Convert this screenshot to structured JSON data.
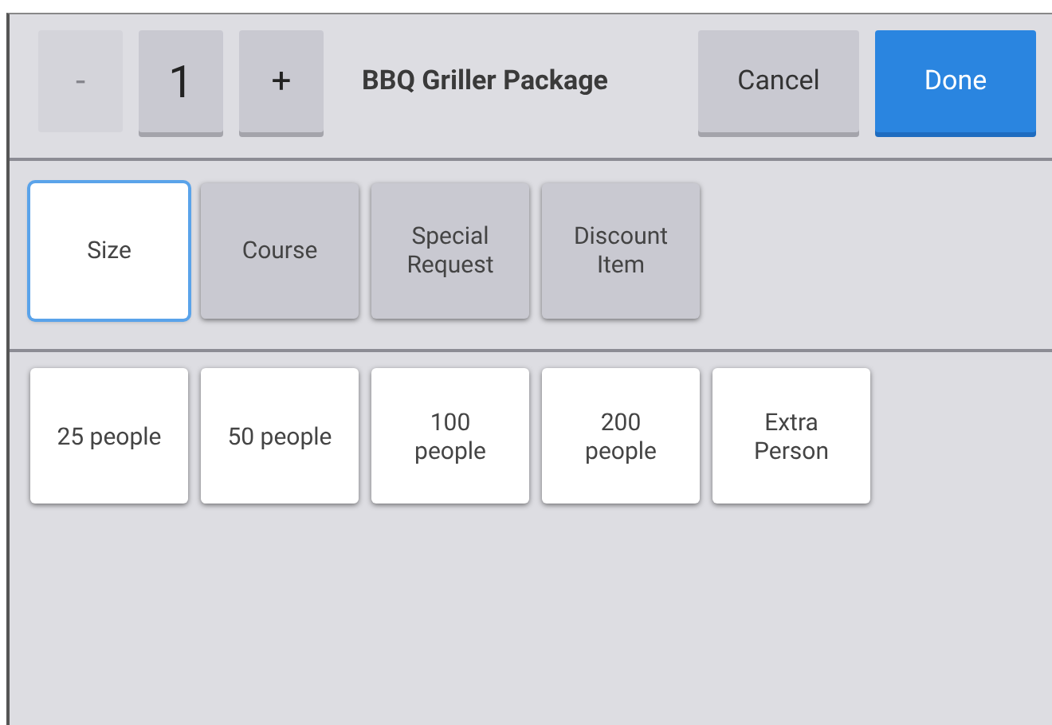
{
  "header": {
    "quantity": "1",
    "decrement": {
      "label": "-",
      "disabled": true
    },
    "increment": {
      "label": "+",
      "disabled": false
    },
    "title": "BBQ Griller Package",
    "cancel": "Cancel",
    "done": "Done"
  },
  "categories": [
    {
      "lines": [
        "Size"
      ],
      "selected": true
    },
    {
      "lines": [
        "Course"
      ],
      "selected": false
    },
    {
      "lines": [
        "Special",
        "Request"
      ],
      "selected": false
    },
    {
      "lines": [
        "Discount",
        "Item"
      ],
      "selected": false
    }
  ],
  "options": [
    {
      "lines": [
        "25 people"
      ]
    },
    {
      "lines": [
        "50 people"
      ]
    },
    {
      "lines": [
        "100",
        "people"
      ]
    },
    {
      "lines": [
        "200",
        "people"
      ]
    },
    {
      "lines": [
        "Extra",
        "Person"
      ]
    }
  ]
}
